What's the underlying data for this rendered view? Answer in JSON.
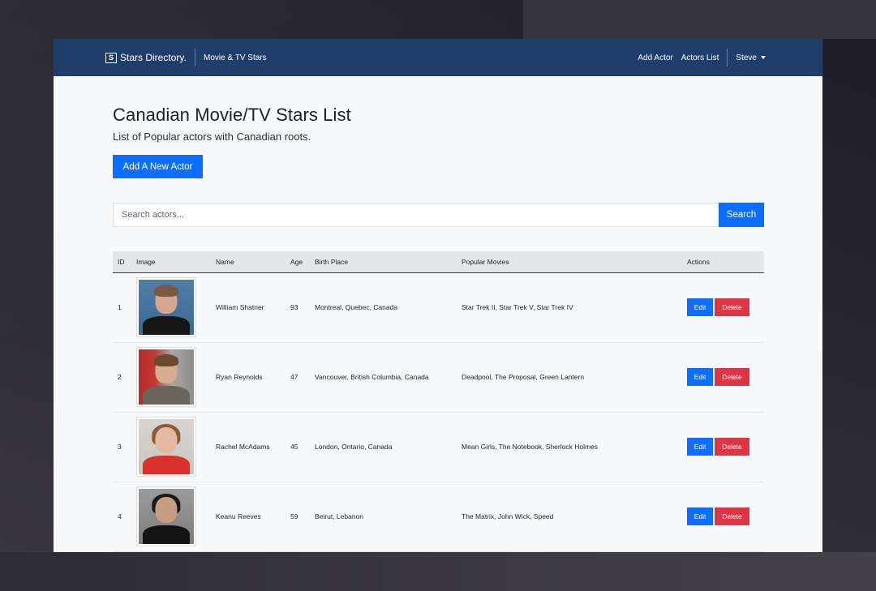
{
  "navbar": {
    "brand_logo": "[S]",
    "brand_text": "Stars Directory.",
    "main_link": "Movie & TV Stars",
    "links": [
      "Add Actor",
      "Actors List"
    ],
    "user": "Steve"
  },
  "page": {
    "title": "Canadian Movie/TV Stars List",
    "subtitle": "List of Popular actors with Canadian roots.",
    "add_button": "Add A New Actor"
  },
  "search": {
    "placeholder": "Search actors...",
    "button": "Search"
  },
  "table": {
    "headers": {
      "id": "ID",
      "image": "Image",
      "name": "Name",
      "age": "Age",
      "birth_place": "Birth Place",
      "movies": "Popular Movies",
      "actions": "Actions"
    },
    "rows": [
      {
        "id": "1",
        "name": "William Shatner",
        "age": "93",
        "birth_place": "Montreal, Quebec, Canada",
        "movies": "Star Trek II, Star Trek V, Star Trek IV"
      },
      {
        "id": "2",
        "name": "Ryan Reynolds",
        "age": "47",
        "birth_place": "Vancouver, British Columbia, Canada",
        "movies": "Deadpool, The Proposal, Green Lantern"
      },
      {
        "id": "3",
        "name": "Rachel McAdams",
        "age": "45",
        "birth_place": "London, Ontario, Canada",
        "movies": "Mean Girls, The Notebook, Sherlock Holmes"
      },
      {
        "id": "4",
        "name": "Keanu Reeves",
        "age": "59",
        "birth_place": "Beirut, Lebanon",
        "movies": "The Matrix, John Wick, Speed"
      }
    ],
    "edit_label": "Edit",
    "delete_label": "Delete"
  },
  "colors": {
    "navbar": "#1f3e6b",
    "primary": "#0d6efd",
    "danger": "#dc3545"
  }
}
